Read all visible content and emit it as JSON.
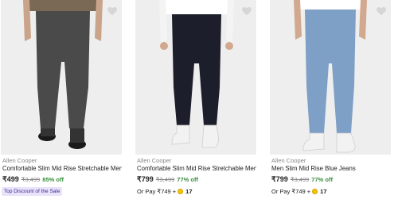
{
  "products": [
    {
      "brand": "Allen Cooper",
      "title": "Comfortable Slim Mid Rise Stretchable Men S...",
      "price": "₹499",
      "mrp": "₹3,499",
      "discount": "85% off",
      "badge": "Top Discount of the Sale",
      "jeans_color": "#4a4a4a",
      "pay_label": null
    },
    {
      "brand": "Allen Cooper",
      "title": "Comfortable Slim Mid Rise Stretchable Men S...",
      "price": "₹799",
      "mrp": "₹3,499",
      "discount": "77% off",
      "badge": null,
      "jeans_color": "#1c1f2b",
      "pay_label": "Or Pay ₹749 +",
      "pay_coins": "17"
    },
    {
      "brand": "Allen Cooper",
      "title": "Men Slim Mid Rise Blue Jeans",
      "price": "₹799",
      "mrp": "₹3,499",
      "discount": "77% off",
      "badge": null,
      "jeans_color": "#7e9fc6",
      "pay_label": "Or Pay ₹749 +",
      "pay_coins": "17"
    }
  ]
}
